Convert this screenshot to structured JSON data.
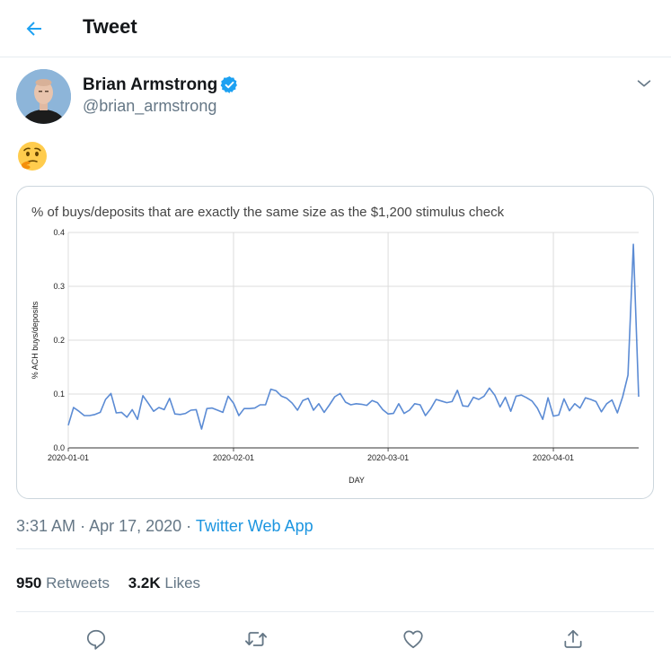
{
  "header": {
    "title": "Tweet"
  },
  "author": {
    "name": "Brian Armstrong",
    "handle": "@brian_armstrong"
  },
  "tweet": {
    "emoji": "thinking-face"
  },
  "chart_data": {
    "type": "line",
    "title": "% of buys/deposits that are exactly the same size as the $1,200 stimulus check",
    "xlabel": "DAY",
    "ylabel": "% ACH buys/deposits",
    "ylim": [
      0,
      0.4
    ],
    "yticks": [
      "0.0",
      "0.1",
      "0.2",
      "0.3",
      "0.4"
    ],
    "xticks": [
      "2020-01-01",
      "2020-02-01",
      "2020-03-01",
      "2020-04-01"
    ],
    "grid": true,
    "series": [
      {
        "color": "#5b8bd4",
        "x_start": "2020-01-01",
        "x_step_days": 1,
        "values": [
          0.042,
          0.075,
          0.068,
          0.06,
          0.06,
          0.062,
          0.066,
          0.09,
          0.101,
          0.065,
          0.066,
          0.057,
          0.071,
          0.053,
          0.097,
          0.083,
          0.068,
          0.075,
          0.071,
          0.092,
          0.063,
          0.062,
          0.064,
          0.07,
          0.071,
          0.035,
          0.073,
          0.074,
          0.07,
          0.066,
          0.096,
          0.083,
          0.06,
          0.073,
          0.073,
          0.074,
          0.08,
          0.08,
          0.109,
          0.106,
          0.096,
          0.092,
          0.083,
          0.07,
          0.088,
          0.092,
          0.07,
          0.082,
          0.066,
          0.08,
          0.095,
          0.101,
          0.085,
          0.08,
          0.082,
          0.081,
          0.079,
          0.088,
          0.084,
          0.071,
          0.063,
          0.064,
          0.082,
          0.064,
          0.07,
          0.082,
          0.08,
          0.06,
          0.073,
          0.09,
          0.087,
          0.084,
          0.086,
          0.107,
          0.078,
          0.077,
          0.094,
          0.09,
          0.096,
          0.111,
          0.098,
          0.076,
          0.094,
          0.068,
          0.096,
          0.098,
          0.093,
          0.087,
          0.074,
          0.053,
          0.093,
          0.059,
          0.061,
          0.091,
          0.069,
          0.082,
          0.074,
          0.093,
          0.09,
          0.086,
          0.067,
          0.082,
          0.089,
          0.065,
          0.095,
          0.135,
          0.378,
          0.095
        ]
      }
    ]
  },
  "meta": {
    "time": "3:31 AM",
    "date": "Apr 17, 2020",
    "separator": "·",
    "app": "Twitter Web App"
  },
  "stats": {
    "retweets": {
      "count": "950",
      "label": "Retweets"
    },
    "likes": {
      "count": "3.2K",
      "label": "Likes"
    }
  },
  "actions": [
    "reply-icon",
    "retweet-icon",
    "like-icon",
    "share-icon"
  ],
  "colors": {
    "accent": "#1da1f2",
    "link": "#1b95e0",
    "muted": "#657786",
    "line": "#5b8bd4"
  }
}
